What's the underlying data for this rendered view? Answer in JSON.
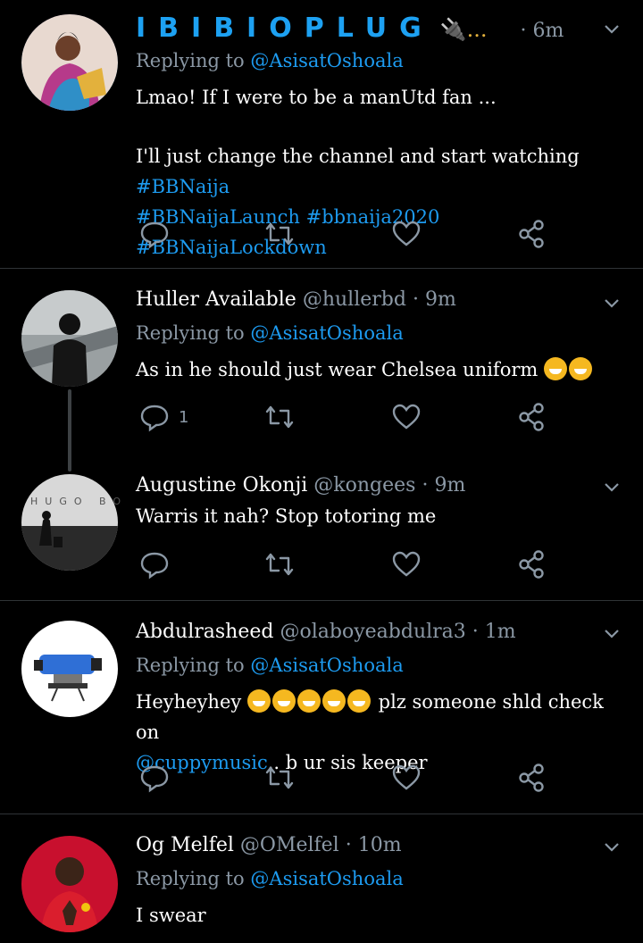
{
  "tweets": [
    {
      "display_name": "IBIBIOPLUG",
      "display_suffix": "🔌...",
      "dot": "·",
      "time": "6m",
      "reply_prefix": "Replying to",
      "reply_to": "@AsisatOshoala",
      "text_line1": "Lmao! If I were to be a manUtd fan ...",
      "text_line2": "I'll just change the channel and start watching",
      "hashtags": [
        "#BBNaija",
        "#BBNaijaLaunch",
        "#bbnaija2020",
        "#BBNaijaLockdown"
      ]
    },
    {
      "display_name": "Huller Available",
      "handle": "@hullerbd",
      "dot": "·",
      "time": "9m",
      "reply_prefix": "Replying to",
      "reply_to": "@AsisatOshoala",
      "text": "As in he should just wear Chelsea uniform",
      "reply_count": "1"
    },
    {
      "display_name": "Augustine Okonji",
      "handle": "@kongees",
      "dot": "·",
      "time": "9m",
      "text": "Warris it nah? Stop totoring me",
      "avatar_text": "HUGO BO"
    },
    {
      "display_name": "Abdulrasheed",
      "handle": "@olaboyeabdulra3",
      "dot": "·",
      "time": "1m",
      "reply_prefix": "Replying to",
      "reply_to": "@AsisatOshoala",
      "text_start": "Heyheyhey",
      "text_mid": "plz someone shld check on",
      "mention": "@cuppymusic",
      "text_end": ".. b ur sis keeper"
    },
    {
      "display_name": "Og Melfel",
      "handle": "@OMelfel",
      "dot": "·",
      "time": "10m",
      "reply_prefix": "Replying to",
      "reply_to": "@AsisatOshoala",
      "text": "I swear"
    }
  ],
  "colors": {
    "link": "#1d9bf0",
    "muted": "#8b98a5",
    "background": "#000000",
    "divider": "#2f3336"
  },
  "icons": [
    "reply-icon",
    "retweet-icon",
    "like-icon",
    "share-icon",
    "chevron-down-icon"
  ]
}
